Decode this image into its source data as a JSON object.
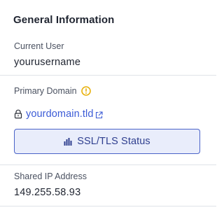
{
  "panel": {
    "title": "General Information"
  },
  "current_user": {
    "label": "Current User",
    "value": "yourusername"
  },
  "primary_domain": {
    "label": "Primary Domain",
    "warning_icon": "warning-circle-icon",
    "lock_icon": "lock-icon",
    "link_text": "yourdomain.tld",
    "external_icon": "external-link-icon",
    "ssl_button": {
      "label": "SSL/TLS Status",
      "icon": "bar-chart-icon"
    }
  },
  "shared_ip": {
    "label": "Shared IP Address",
    "value": "149.255.58.93"
  },
  "colors": {
    "link": "#3b5bd6",
    "warning": "#e8b10c",
    "button_bg": "#e9edfb",
    "button_border": "#4a63c8",
    "divider": "#dfe3e8"
  }
}
